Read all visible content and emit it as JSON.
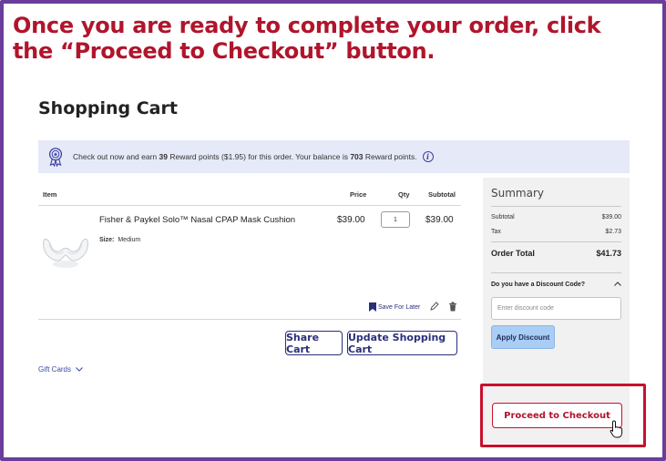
{
  "banner": {
    "line1": "Once you are ready to complete your order, click",
    "line2": "the “Proceed to Checkout” button."
  },
  "page": {
    "title": "Shopping Cart"
  },
  "reward": {
    "text_before": "Check out now and earn ",
    "points": "39",
    "text_middle": " Reward points ($1.95) for this order. Your balance is ",
    "balance": "703",
    "text_after": " Reward points.",
    "info": "i",
    "icon": "award-ribbon-icon"
  },
  "cart": {
    "columns": {
      "item": "Item",
      "price": "Price",
      "qty": "Qty",
      "subtotal": "Subtotal"
    },
    "items": [
      {
        "name": "Fisher & Paykel Solo™ Nasal CPAP Mask Cushion",
        "size_label": "Size:",
        "size_value": "Medium",
        "price": "$39.00",
        "qty": "1",
        "subtotal": "$39.00",
        "image_icon": "cpap-cushion-image"
      }
    ],
    "save_for_later": "Save For Later",
    "share_cart": "Share Cart",
    "update_cart": "Update Shopping Cart",
    "gift_cards": "Gift Cards"
  },
  "summary": {
    "title": "Summary",
    "subtotal_label": "Subtotal",
    "subtotal_value": "$39.00",
    "tax_label": "Tax",
    "tax_value": "$2.73",
    "total_label": "Order Total",
    "total_value": "$41.73",
    "discount_question": "Do you have a Discount Code?",
    "discount_placeholder": "Enter discount code",
    "apply_label": "Apply Discount",
    "checkout_label": "Proceed to Checkout"
  },
  "colors": {
    "banner_text": "#b0152c",
    "frame": "#6a3d9a",
    "highlight": "#c8102e",
    "link": "#2a2f7a",
    "reward_bg": "#e6e9f8",
    "apply_bg": "#a9cdf5"
  }
}
